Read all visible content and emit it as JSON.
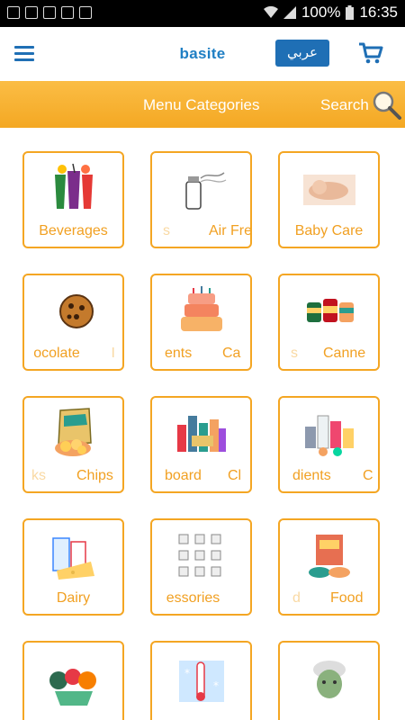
{
  "status": {
    "battery": "100%",
    "time": "16:35"
  },
  "header": {
    "brand": "basite",
    "lang_button": "عربي"
  },
  "category_bar": {
    "title": "Menu Categories",
    "search_label": "Search"
  },
  "categories": [
    {
      "label": "Beverages",
      "icon": "beverages-icon"
    },
    {
      "label": "Air Fres",
      "icon": "air-freshener-icon"
    },
    {
      "label": "Baby Care",
      "icon": "baby-care-icon"
    },
    {
      "label": "ocolate",
      "icon": "chocolate-icon"
    },
    {
      "label": "ents",
      "label2": "Ca",
      "icon": "cake-icon"
    },
    {
      "label": "Canne",
      "icon": "canned-food-icon"
    },
    {
      "label": "Chips",
      "icon": "chips-icon"
    },
    {
      "label": "board",
      "label2": "Cl",
      "icon": "cupboard-icon"
    },
    {
      "label": "dients",
      "label2": "C",
      "icon": "ingredients-icon"
    },
    {
      "label": "Dairy",
      "icon": "dairy-icon"
    },
    {
      "label": "essories",
      "icon": "accessories-icon"
    },
    {
      "label": "Food",
      "icon": "food-icon"
    },
    {
      "label": "",
      "icon": "vegetables-icon"
    },
    {
      "label": "",
      "icon": "frozen-icon"
    },
    {
      "label": "",
      "icon": "face-care-icon"
    }
  ],
  "colors": {
    "accent": "#f4a623",
    "brand_blue": "#1f6fb5"
  }
}
